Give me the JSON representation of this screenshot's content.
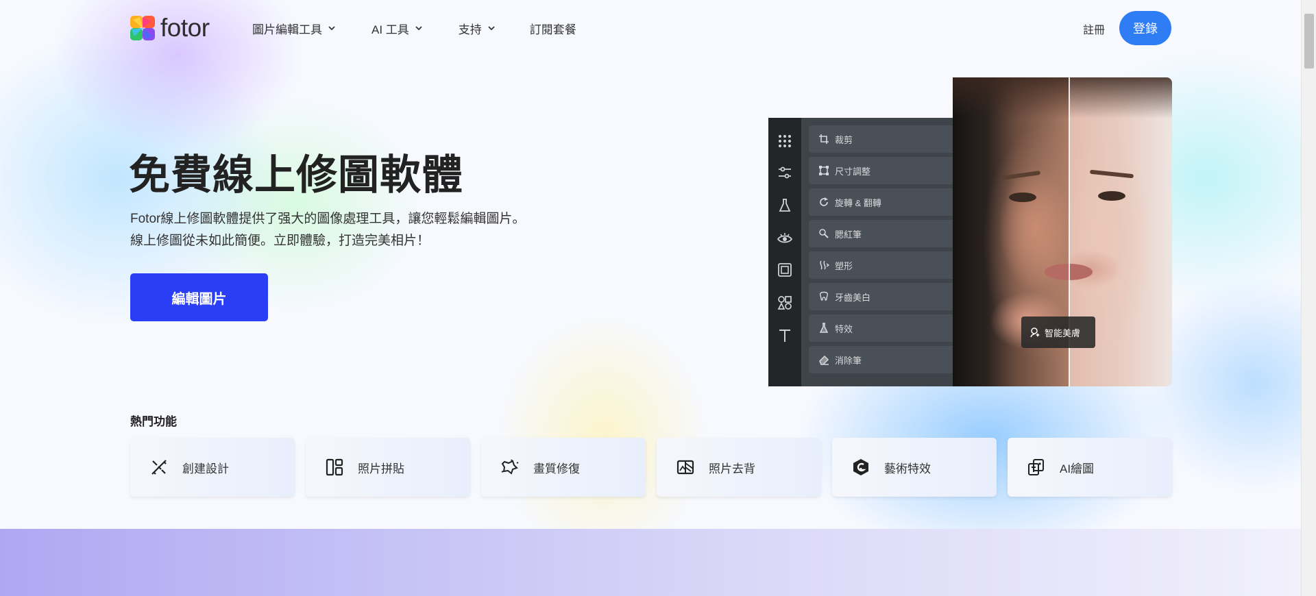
{
  "header": {
    "logo_text": "fotor",
    "nav": [
      {
        "label": "圖片編輯工具",
        "has_dropdown": true
      },
      {
        "label": "AI 工具",
        "has_dropdown": true
      },
      {
        "label": "支持",
        "has_dropdown": true
      },
      {
        "label": "訂閱套餐",
        "has_dropdown": false
      }
    ],
    "signup_label": "註冊",
    "login_label": "登錄"
  },
  "hero": {
    "title": "免費線上修圖軟體",
    "description_line1": "Fotor線上修圖軟體提供了强大的圖像處理工具，讓您輕鬆編輯圖片。",
    "description_line2": "線上修圖從未如此簡便。立即體驗，打造完美相片！",
    "cta_label": "編輯圖片"
  },
  "editor_mock": {
    "rail_icons": [
      "grid-icon",
      "sliders-icon",
      "flask-icon",
      "eye-icon",
      "frame-icon",
      "shapes-icon",
      "text-icon"
    ],
    "tools": [
      {
        "label": "裁剪",
        "icon": "crop-icon"
      },
      {
        "label": "尺寸調整",
        "icon": "resize-icon"
      },
      {
        "label": "旋轉 & 翻轉",
        "icon": "rotate-icon"
      },
      {
        "label": "腮紅筆",
        "icon": "blush-brush-icon"
      },
      {
        "label": "塑形",
        "icon": "reshape-icon"
      },
      {
        "label": "牙齒美白",
        "icon": "tooth-icon"
      },
      {
        "label": "特效",
        "icon": "effect-icon"
      },
      {
        "label": "消除筆",
        "icon": "eraser-icon"
      }
    ],
    "beauty_badge_label": "智能美膚"
  },
  "hot_features": {
    "title": "熱門功能",
    "items": [
      {
        "label": "創建設計",
        "icon": "design-icon"
      },
      {
        "label": "照片拼貼",
        "icon": "collage-icon"
      },
      {
        "label": "畫質修復",
        "icon": "enhance-icon"
      },
      {
        "label": "照片去背",
        "icon": "remove-background-icon"
      },
      {
        "label": "藝術特效",
        "icon": "art-effect-icon"
      },
      {
        "label": "AI繪圖",
        "icon": "ai-drawing-icon"
      }
    ]
  },
  "colors": {
    "login_button": "#2f7df5",
    "cta_button": "#2a3ef5",
    "editor_panel": "#3f444a"
  }
}
